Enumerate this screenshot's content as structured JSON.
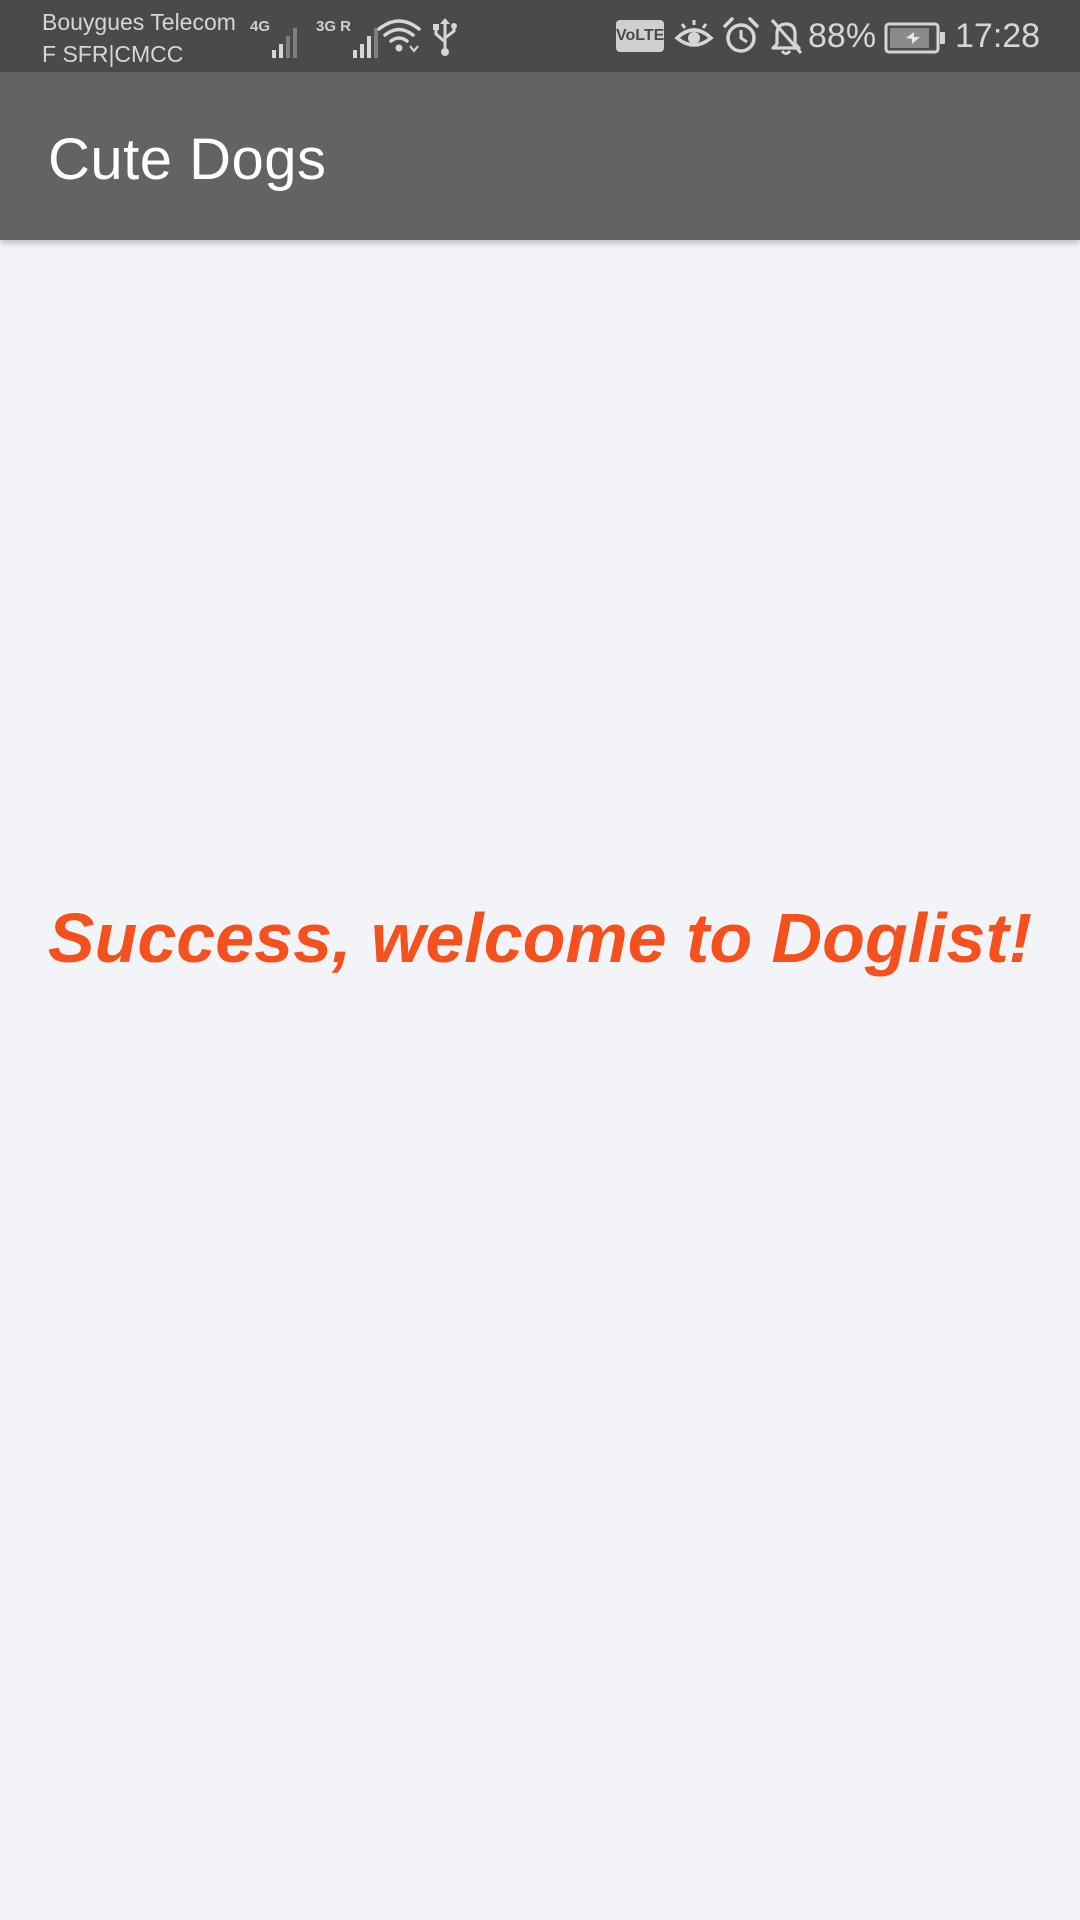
{
  "status_bar": {
    "carrier_line1": "Bouygues Telecom",
    "carrier_line2": "F SFR|CMCC",
    "network1_tag": "4G",
    "network2_tag": "3G R",
    "volte_label": "VoLTE",
    "battery_percent": "88%",
    "battery_level": 0.88,
    "time": "17:28",
    "icons": [
      "signal-4g-icon",
      "signal-3g-roaming-icon",
      "wifi-icon",
      "usb-icon",
      "volte-icon",
      "eye-comfort-icon",
      "alarm-icon",
      "notifications-off-icon",
      "battery-charging-icon"
    ]
  },
  "app_bar": {
    "title": "Cute Dogs"
  },
  "main": {
    "message": "Success, welcome to Doglist!",
    "message_color": "#f4511e"
  },
  "colors": {
    "status_bar_bg": "#4a4a4c",
    "app_bar_bg": "#636366",
    "background": "#f3f4f8"
  }
}
